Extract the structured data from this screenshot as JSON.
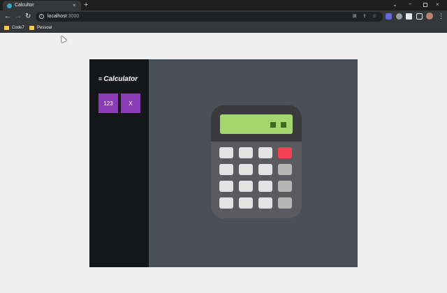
{
  "browser": {
    "tab_title": "Calcultor",
    "tab_close": "×",
    "new_tab": "+",
    "tab_search": "⌄",
    "window_minimize": "–",
    "window_close": "×",
    "back": "←",
    "forward": "→",
    "reload": "↻",
    "url_host": "localhost",
    "url_port": ":3000",
    "share_icon": "⇪",
    "star_icon": "☆",
    "kebab": "⋮"
  },
  "bookmarks": [
    {
      "label": "Code7"
    },
    {
      "label": "Pessoal"
    }
  ],
  "sidebar": {
    "menu_icon": "≡",
    "title": "Calculator",
    "buttons": [
      {
        "label": "123"
      },
      {
        "label": "X"
      }
    ]
  },
  "illustration": {
    "body_color": "#5b5a5e",
    "screen_color": "#a3d76e",
    "screen_digit_color": "#3d6b25",
    "key_color": "#e3e3e3",
    "op_key_color": "#b5b5b5",
    "accent_key_color": "#f24152"
  }
}
